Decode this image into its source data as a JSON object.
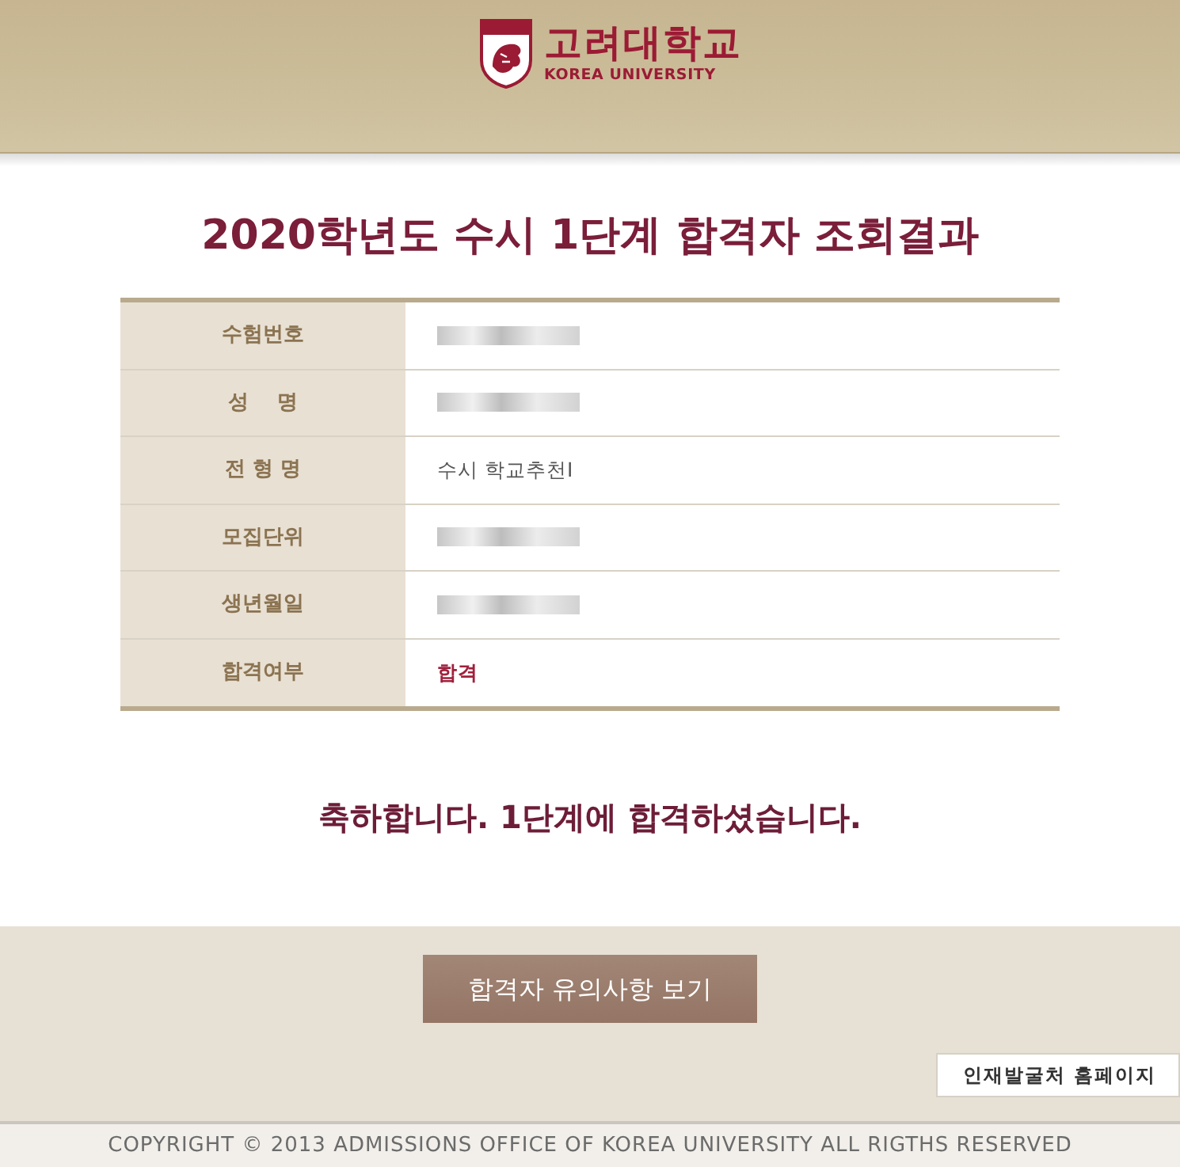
{
  "header": {
    "logo": {
      "name_ko": "고려대학교",
      "name_en": "KOREA UNIVERSITY"
    }
  },
  "title": "2020학년도 수시 1단계 합격자 조회결과",
  "result_table": {
    "rows": [
      {
        "label": "수험번호",
        "redacted": true,
        "highlighted": false
      },
      {
        "label": "성    명",
        "redacted": true,
        "highlighted": false
      },
      {
        "label": "전 형 명",
        "value": "수시 학교추천I",
        "redacted": false,
        "highlighted": false
      },
      {
        "label": "모집단위",
        "redacted": true,
        "highlighted": false
      },
      {
        "label": "생년월일",
        "redacted": true,
        "highlighted": false
      },
      {
        "label": "합격여부",
        "value": "합격",
        "redacted": false,
        "highlighted": true
      }
    ]
  },
  "message": "축하합니다. 1단계에 합격하셨습니다.",
  "actions": {
    "notice_button": "합격자 유의사항 보기",
    "side_link": "인재발굴처 홈페이지"
  },
  "footer": {
    "copyright": "COPYRIGHT © 2013 ADMISSIONS OFFICE OF KOREA UNIVERSITY ALL RIGTHS RESERVED"
  }
}
